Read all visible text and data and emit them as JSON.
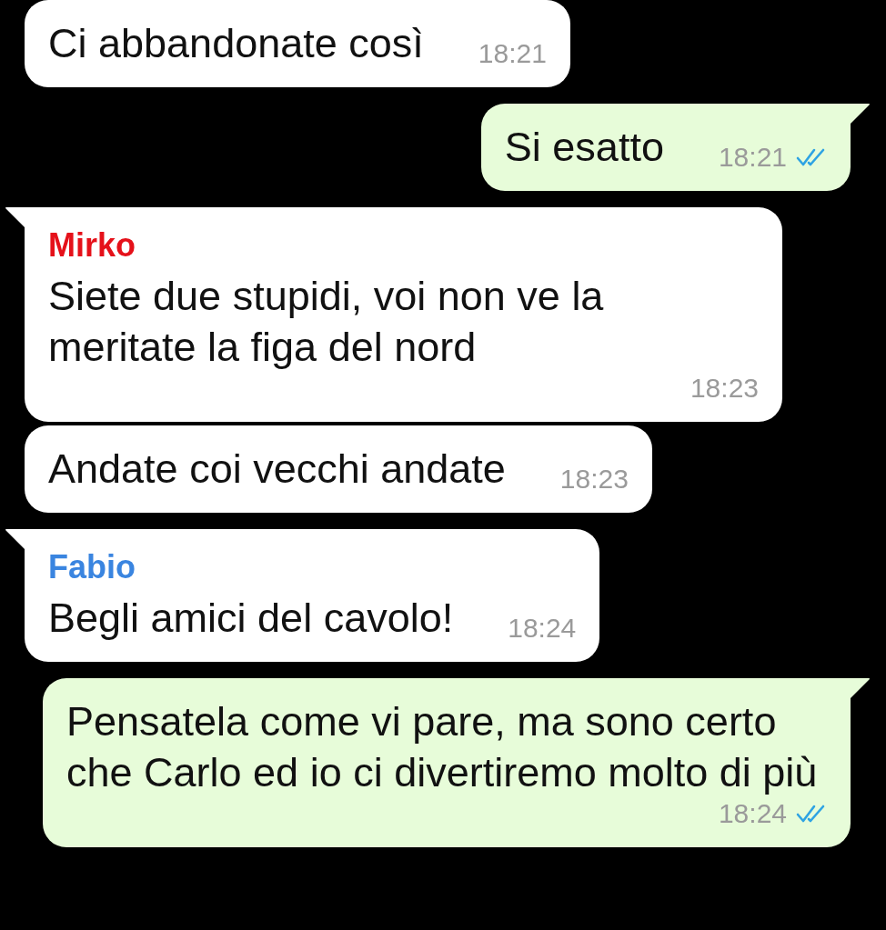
{
  "messages": [
    {
      "kind": "incoming",
      "tail": false,
      "text": "Ci abbandonate così",
      "time": "18:21"
    },
    {
      "kind": "outgoing",
      "tail": true,
      "text": "Si esatto",
      "time": "18:21",
      "read": true
    },
    {
      "kind": "incoming",
      "tail": true,
      "sender": "Mirko",
      "color": "#e5111a",
      "text": "Siete due stupidi, voi non ve la meritate la figa del nord",
      "time": "18:23"
    },
    {
      "kind": "incoming",
      "tail": false,
      "text": "Andate coi vecchi andate",
      "time": "18:23"
    },
    {
      "kind": "incoming",
      "tail": true,
      "sender": "Fabio",
      "color": "#3a85e0",
      "text": "Begli amici del cavolo!",
      "time": "18:24"
    },
    {
      "kind": "outgoing",
      "tail": true,
      "text": "Pensatela come vi pare, ma sono certo che Carlo ed io ci divertiremo molto di più",
      "time": "18:24",
      "read": true
    }
  ]
}
